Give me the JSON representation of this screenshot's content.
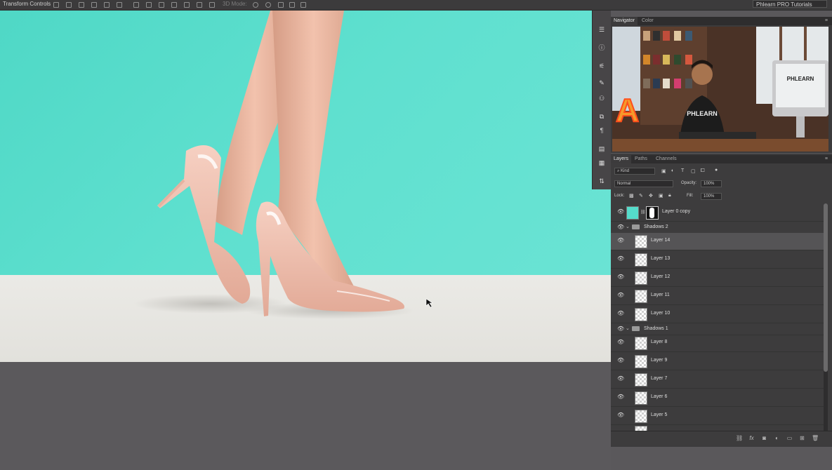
{
  "options_bar": {
    "transform_label": "Transform Controls",
    "mode_label": "3D Mode:",
    "workspace": "Phlearn PRO Tutorials"
  },
  "navigator": {
    "tabs": [
      "Navigator",
      "Color"
    ],
    "video_text": {
      "shirt": "PHLEARN",
      "monitor": "PHLEARN",
      "sign_letter": "A"
    }
  },
  "layers_panel": {
    "tabs": [
      "Layers",
      "Paths",
      "Channels"
    ],
    "filter_kind": "Kind",
    "blend_mode": "Normal",
    "opacity_label": "Opacity:",
    "opacity_value": "100%",
    "lock_label": "Lock:",
    "fill_label": "Fill:",
    "fill_value": "100%",
    "rows": [
      {
        "type": "layer",
        "name": "Layer 0 copy",
        "mask": true
      },
      {
        "type": "group",
        "name": "Shadows 2"
      },
      {
        "type": "layer",
        "name": "Layer 14",
        "selected": true
      },
      {
        "type": "layer",
        "name": "Layer 13"
      },
      {
        "type": "layer",
        "name": "Layer 12"
      },
      {
        "type": "layer",
        "name": "Layer 11"
      },
      {
        "type": "layer",
        "name": "Layer 10"
      },
      {
        "type": "group",
        "name": "Shadows 1"
      },
      {
        "type": "layer",
        "name": "Layer 8"
      },
      {
        "type": "layer",
        "name": "Layer 9"
      },
      {
        "type": "layer",
        "name": "Layer 7"
      },
      {
        "type": "layer",
        "name": "Layer 6"
      },
      {
        "type": "layer",
        "name": "Layer 5"
      }
    ],
    "footer_icons": [
      "link-icon",
      "fx-icon",
      "mask-icon",
      "adjustment-icon",
      "group-icon",
      "new-layer-icon",
      "trash-icon"
    ]
  },
  "tool_strip_icons": [
    "history-icon",
    "info-icon",
    "adjustments-icon",
    "brush-icon",
    "character-icon",
    "clone-icon",
    "paragraph-icon",
    "libraries-icon",
    "notes-icon",
    "properties-icon"
  ],
  "colors": {
    "canvas_teal": "#55dccb",
    "floor": "#e8e7e2",
    "shoe_pink": "#f0c0b0",
    "panel_bg": "#3d3c3d",
    "selected_row": "#555456"
  }
}
